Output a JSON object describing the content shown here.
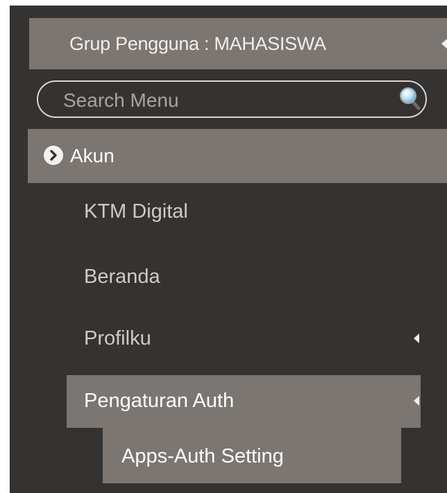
{
  "sidebar": {
    "group": {
      "label": "Grup Pengguna : MAHASISWA"
    },
    "search": {
      "placeholder": "Search Menu",
      "icon": "search-icon"
    },
    "section": {
      "label": "Akun",
      "icon": "chevron-right-circle-icon"
    },
    "items": [
      {
        "label": "KTM Digital"
      },
      {
        "label": "Beranda"
      },
      {
        "label": "Profilku",
        "icon": "caret-left-icon"
      },
      {
        "label": "Pengaturan Auth",
        "icon": "caret-left-icon",
        "active": true
      }
    ],
    "subitems": [
      {
        "label": "Apps-Auth Setting",
        "active": true
      }
    ]
  },
  "colors": {
    "sidebar_bg": "#343332",
    "active_bg": "#7c7672",
    "text_muted": "#cdcac7",
    "text_active": "#ffffff"
  }
}
